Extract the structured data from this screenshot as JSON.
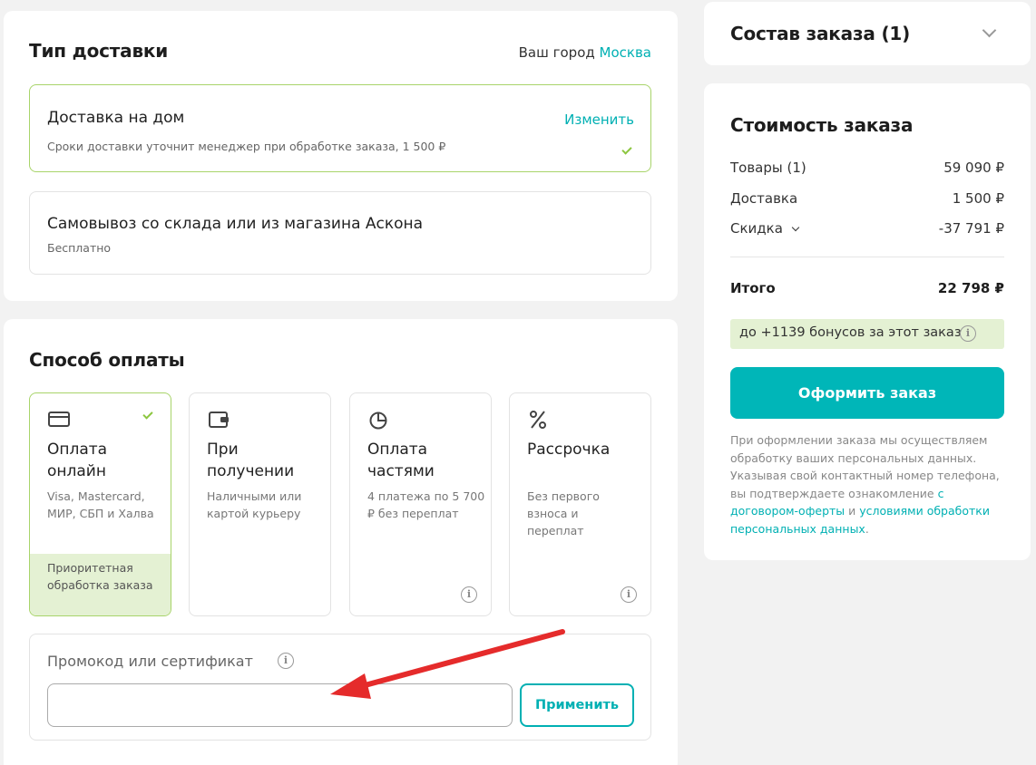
{
  "delivery": {
    "title": "Тип доставки",
    "city_label": "Ваш город",
    "city_value": "Москва",
    "options": [
      {
        "title": "Доставка на дом",
        "desc": "Сроки доставки уточнит менеджер при обработке заказа, 1 500 ₽",
        "action": "Изменить"
      },
      {
        "title": "Самовывоз со склада или из магазина Аскона",
        "desc": "Бесплатно"
      }
    ]
  },
  "payment": {
    "title": "Способ оплаты",
    "methods": [
      {
        "title": "Оплата онлайн",
        "desc": "Visa, Mastercard, МИР, СБП и Халва",
        "badge": "Приоритетная обработка заказа",
        "icon": "credit-card-icon"
      },
      {
        "title": "При получении",
        "desc": "Наличными или картой курьеру",
        "icon": "wallet-icon"
      },
      {
        "title": "Оплата частями",
        "desc": "4 платежа по 5 700 ₽ без переплат",
        "icon": "pie-chart-icon"
      },
      {
        "title": "Рассрочка",
        "desc": "Без первого взноса и переплат",
        "icon": "percent-icon"
      }
    ],
    "promo": {
      "label": "Промокод или сертификат",
      "placeholder": "",
      "apply": "Применить"
    }
  },
  "order": {
    "title": "Состав заказа (1)"
  },
  "summary": {
    "title": "Стоимость заказа",
    "rows": [
      {
        "label": "Товары (1)",
        "value": "59 090 ₽"
      },
      {
        "label": "Доставка",
        "value": "1 500 ₽"
      },
      {
        "label": "Скидка",
        "value": "-37 791 ₽"
      }
    ],
    "total_label": "Итого",
    "total_value": "22 798 ₽",
    "bonus": "до +1139 бонусов за этот заказ",
    "checkout": "Оформить заказ",
    "legal_text": "При оформлении заказа мы осуществляем обработку ваших персональных данных. Указывая свой контактный номер телефона, вы подтверждаете ознакомление",
    "legal_link1": "с договором-оферты",
    "legal_and": "и",
    "legal_link2": "условиями обработки персональных данных",
    "legal_end": "."
  },
  "colors": {
    "accent": "#00b0b3",
    "selected_border": "#a8d46a",
    "badge_bg": "#e4f1d3",
    "arrow": "#e52b2b"
  }
}
